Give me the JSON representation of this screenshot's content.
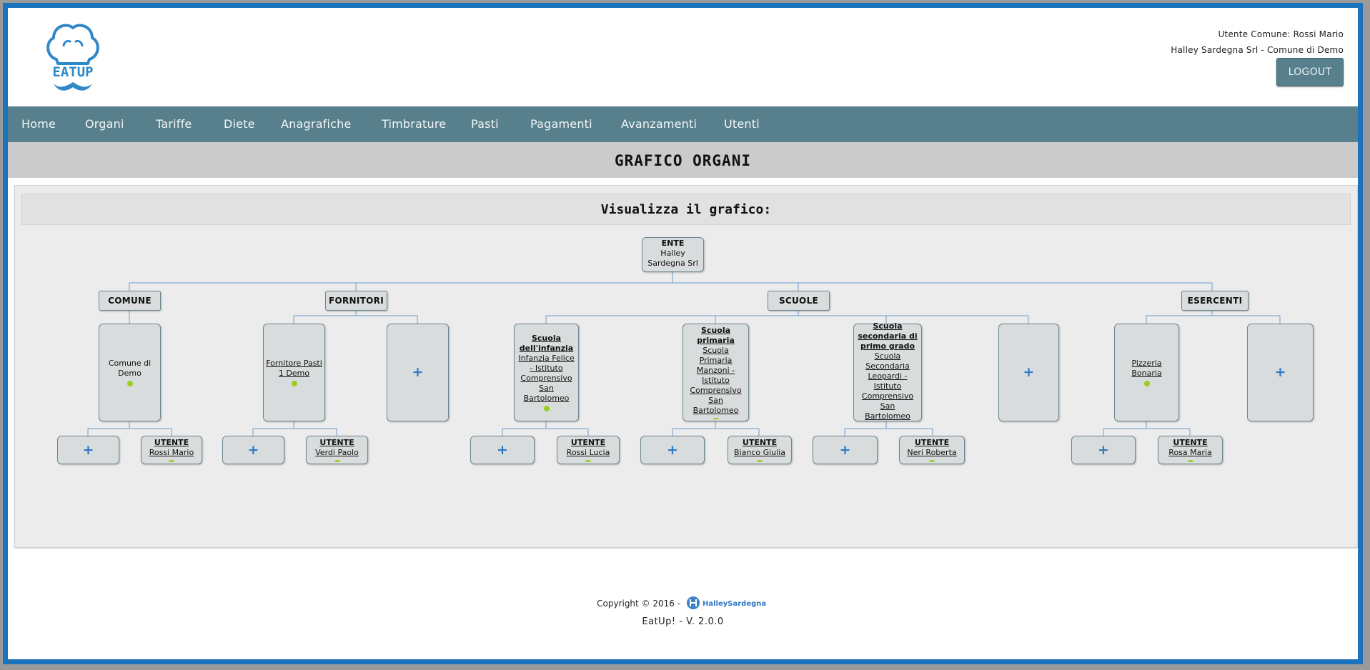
{
  "header": {
    "logo_text": "EATUP",
    "user_line": "Utente Comune: Rossi Mario",
    "org_line": "Halley Sardegna Srl - Comune di Demo",
    "logout_label": "LOGOUT"
  },
  "nav": {
    "items": [
      "Home",
      "Organi",
      "Tariffe",
      "Diete",
      "Anagrafiche",
      "Timbrature",
      "Pasti",
      "Pagamenti",
      "Avanzamenti",
      "Utenti"
    ]
  },
  "page_title": "GRAFICO ORGANI",
  "panel": {
    "subtitle": "Visualizza il grafico:",
    "plus_icon": "+",
    "root": {
      "label": "ENTE",
      "name": "Halley Sardegna Srl"
    },
    "categories": {
      "comune": "COMUNE",
      "fornitori": "FORNITORI",
      "scuole": "SCUOLE",
      "esercenti": "ESERCENTI"
    },
    "entities": {
      "comune": "Comune di Demo",
      "fornitore": "Fornitore Pasti 1 Demo",
      "infanzia_type": "Scuola dell'infanzia",
      "infanzia_name": "Infanzia Felice - Istituto Comprensivo San Bartolomeo",
      "primaria_type": "Scuola primaria",
      "primaria_name": "Scuola Primaria Manzoni - Istituto Comprensivo San Bartolomeo",
      "secondaria_type": "Scuola secondaria di primo grado",
      "secondaria_name": "Scuola Secondaria Leopardi - Istituto Comprensivo San Bartolomeo",
      "esercente": "Pizzeria Bonaria"
    },
    "user_label": "UTENTE",
    "users": {
      "comune": "Rossi Mario",
      "fornitore": "Verdi Paolo",
      "infanzia": "Rossi Lucia",
      "primaria": "Bianco Giulia",
      "secondaria": "Neri Roberta",
      "esercente": "Rosa Maria"
    },
    "status_color": "#9acd22"
  },
  "footer": {
    "copyright": "Copyright © 2016 -",
    "company_logo_text": "HalleySardegna",
    "version": "EatUp! - V. 2.0.0"
  },
  "colors": {
    "brand_blue": "#1b72bd",
    "nav_bg": "#57808c",
    "title_band_bg": "#cbcbcb",
    "node_bg": "#d9dcdd"
  }
}
